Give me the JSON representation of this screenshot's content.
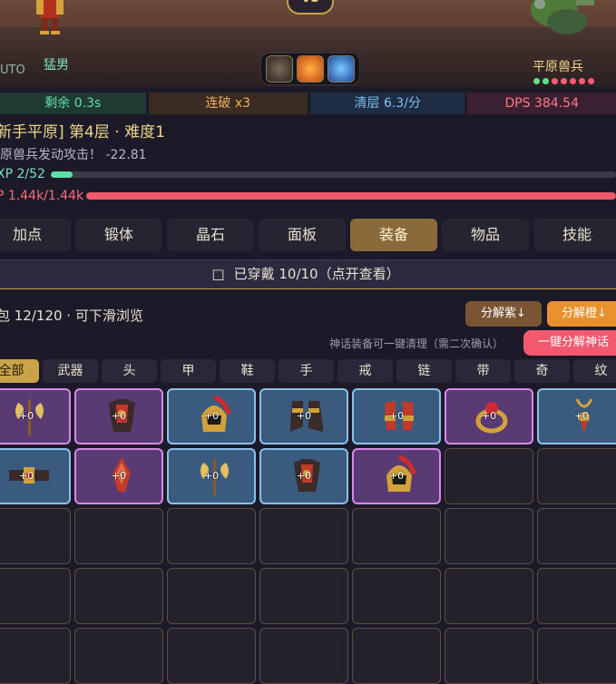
{
  "banner": {
    "vs": "VS",
    "auto": "UTO",
    "hero_name": "猛男",
    "enemy_name": "平原兽兵",
    "enemy_dot_colors": [
      "#5fe08a",
      "#5fe08a",
      "#ff5a7a",
      "#ff5a7a",
      "#ff5a7a",
      "#ff5a7a",
      "#ff5a7a"
    ],
    "skills": [
      "wolf-icon",
      "fire-icon",
      "frost-icon"
    ]
  },
  "stats": [
    {
      "text": "剩余 0.3s",
      "color": "#5fe0a8",
      "bg": "#1f3a30"
    },
    {
      "text": "连破 x3",
      "color": "#f0b060",
      "bg": "#3a2c22"
    },
    {
      "text": "清层 6.3/分",
      "color": "#7fc0ee",
      "bg": "#1e2c44"
    },
    {
      "text": "DPS 384.54",
      "color": "#ff7a8a",
      "bg": "#3a2030"
    }
  ],
  "stage": {
    "title": "新手平原] 第4层 · 难度1",
    "log": "原兽兵发动攻击！ -22.81",
    "xp_label": "XP 2/52",
    "xp_fraction": 0.038,
    "hp_label": "P 1.44k/1.44k",
    "hp_fraction": 1.0
  },
  "tabs": [
    {
      "label": "加点",
      "active": false
    },
    {
      "label": "锻体",
      "active": false
    },
    {
      "label": "晶石",
      "active": false
    },
    {
      "label": "面板",
      "active": false
    },
    {
      "label": "装备",
      "active": true
    },
    {
      "label": "物品",
      "active": false
    },
    {
      "label": "技能",
      "active": false
    }
  ],
  "equip_bar": "已穿戴 10/10（点开查看）",
  "bag": {
    "label": "包 12/120 · 可下滑浏览",
    "decompose_purple": "分解紫↓",
    "decompose_orange": "分解橙↓",
    "myth_hint": "神话装备可一键清理（需二次确认）",
    "myth_button": "一键分解神话"
  },
  "filters": [
    {
      "label": "全部",
      "active": true
    },
    {
      "label": "武器",
      "active": false
    },
    {
      "label": "头",
      "active": false
    },
    {
      "label": "甲",
      "active": false
    },
    {
      "label": "鞋",
      "active": false
    },
    {
      "label": "手",
      "active": false
    },
    {
      "label": "戒",
      "active": false
    },
    {
      "label": "链",
      "active": false
    },
    {
      "label": "带",
      "active": false
    },
    {
      "label": "奇",
      "active": false
    },
    {
      "label": "纹",
      "active": false
    }
  ],
  "items": [
    {
      "rarity": "purple",
      "icon": "axe-icon",
      "level": "+0"
    },
    {
      "rarity": "purple",
      "icon": "armor-icon",
      "level": "+0"
    },
    {
      "rarity": "blue",
      "icon": "helmet-icon",
      "level": "+0"
    },
    {
      "rarity": "blue",
      "icon": "boots-icon",
      "level": "+0"
    },
    {
      "rarity": "blue",
      "icon": "gloves-icon",
      "level": "+0"
    },
    {
      "rarity": "purple",
      "icon": "ring-icon",
      "level": "+0"
    },
    {
      "rarity": "blue",
      "icon": "necklace-icon",
      "level": "+0"
    },
    {
      "rarity": "blue",
      "icon": "belt-icon",
      "level": "+0"
    },
    {
      "rarity": "purple",
      "icon": "trinket-icon",
      "level": "+0"
    },
    {
      "rarity": "blue",
      "icon": "axe-icon",
      "level": "+0"
    },
    {
      "rarity": "blue",
      "icon": "armor-icon",
      "level": "+0"
    },
    {
      "rarity": "purple",
      "icon": "helmet-icon",
      "level": "+0"
    }
  ],
  "empty_slots": 23
}
